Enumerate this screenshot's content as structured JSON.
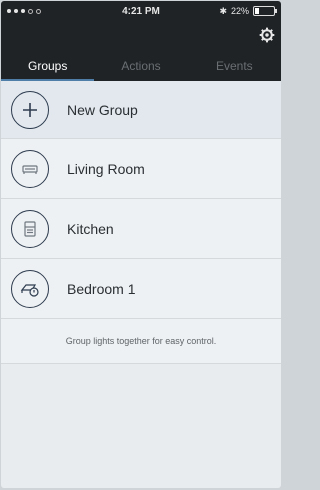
{
  "status": {
    "time": "4:21 PM",
    "battery_text": "22%"
  },
  "tabs": [
    {
      "label": "Groups",
      "active": true
    },
    {
      "label": "Actions",
      "active": false
    },
    {
      "label": "Events",
      "active": false
    }
  ],
  "groups": [
    {
      "label": "New Group",
      "icon": "plus-icon"
    },
    {
      "label": "Living Room",
      "icon": "sofa-icon"
    },
    {
      "label": "Kitchen",
      "icon": "fridge-icon"
    },
    {
      "label": "Bedroom 1",
      "icon": "bed-clock-icon"
    }
  ],
  "hint": "Group lights together for easy control.",
  "colors": {
    "header_bg": "#1f2326",
    "accent": "#4f7fa8",
    "list_bg": "#eef1f3"
  }
}
